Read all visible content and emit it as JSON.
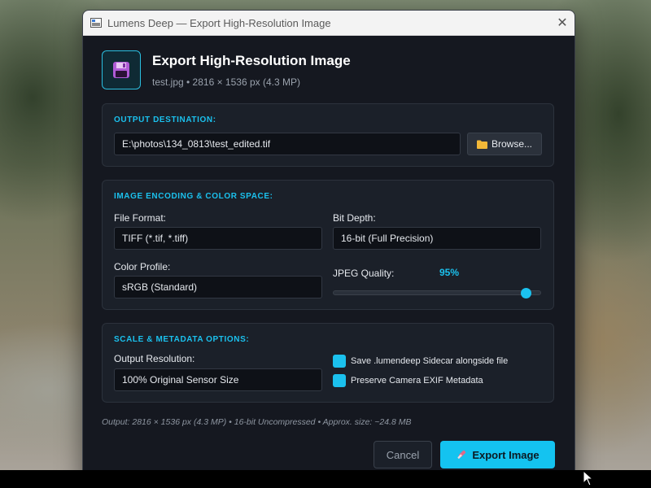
{
  "window": {
    "title": "Lumens Deep — Export High-Resolution Image",
    "close_glyph": "✕"
  },
  "header": {
    "title": "Export High-Resolution Image",
    "subtitle": "test.jpg • 2816 × 1536 px (4.3 MP)",
    "icon": "floppy-disk-icon"
  },
  "output": {
    "section_title": "OUTPUT DESTINATION:",
    "path_value": "E:\\photos\\134_0813\\test_edited.tif",
    "browse_label": "Browse...",
    "browse_icon": "folder-icon"
  },
  "encoding": {
    "section_title": "IMAGE ENCODING & COLOR SPACE:",
    "file_format_label": "File Format:",
    "file_format_value": "TIFF (*.tif, *.tiff)",
    "bit_depth_label": "Bit Depth:",
    "bit_depth_value": "16-bit (Full Precision)",
    "color_profile_label": "Color Profile:",
    "color_profile_value": "sRGB (Standard)",
    "jpeg_quality_label": "JPEG Quality:",
    "jpeg_quality_text": "95%",
    "jpeg_quality_value": 95
  },
  "scale": {
    "section_title": "SCALE & METADATA OPTIONS:",
    "resolution_label": "Output Resolution:",
    "resolution_value": "100% Original Sensor Size",
    "sidecar_label": "Save .lumendeep Sidecar alongside file",
    "sidecar_checked": true,
    "exif_label": "Preserve Camera EXIF Metadata",
    "exif_checked": true
  },
  "footer": {
    "info": "Output: 2816 × 1536 px (4.3 MP) • 16-bit Uncompressed • Approx. size: ~24.8 MB",
    "cancel_label": "Cancel",
    "export_label": "Export Image",
    "export_icon": "brush-icon"
  },
  "colors": {
    "accent": "#1bc1ee",
    "dialog_bg": "#151820",
    "section_bg": "#1b2029"
  }
}
